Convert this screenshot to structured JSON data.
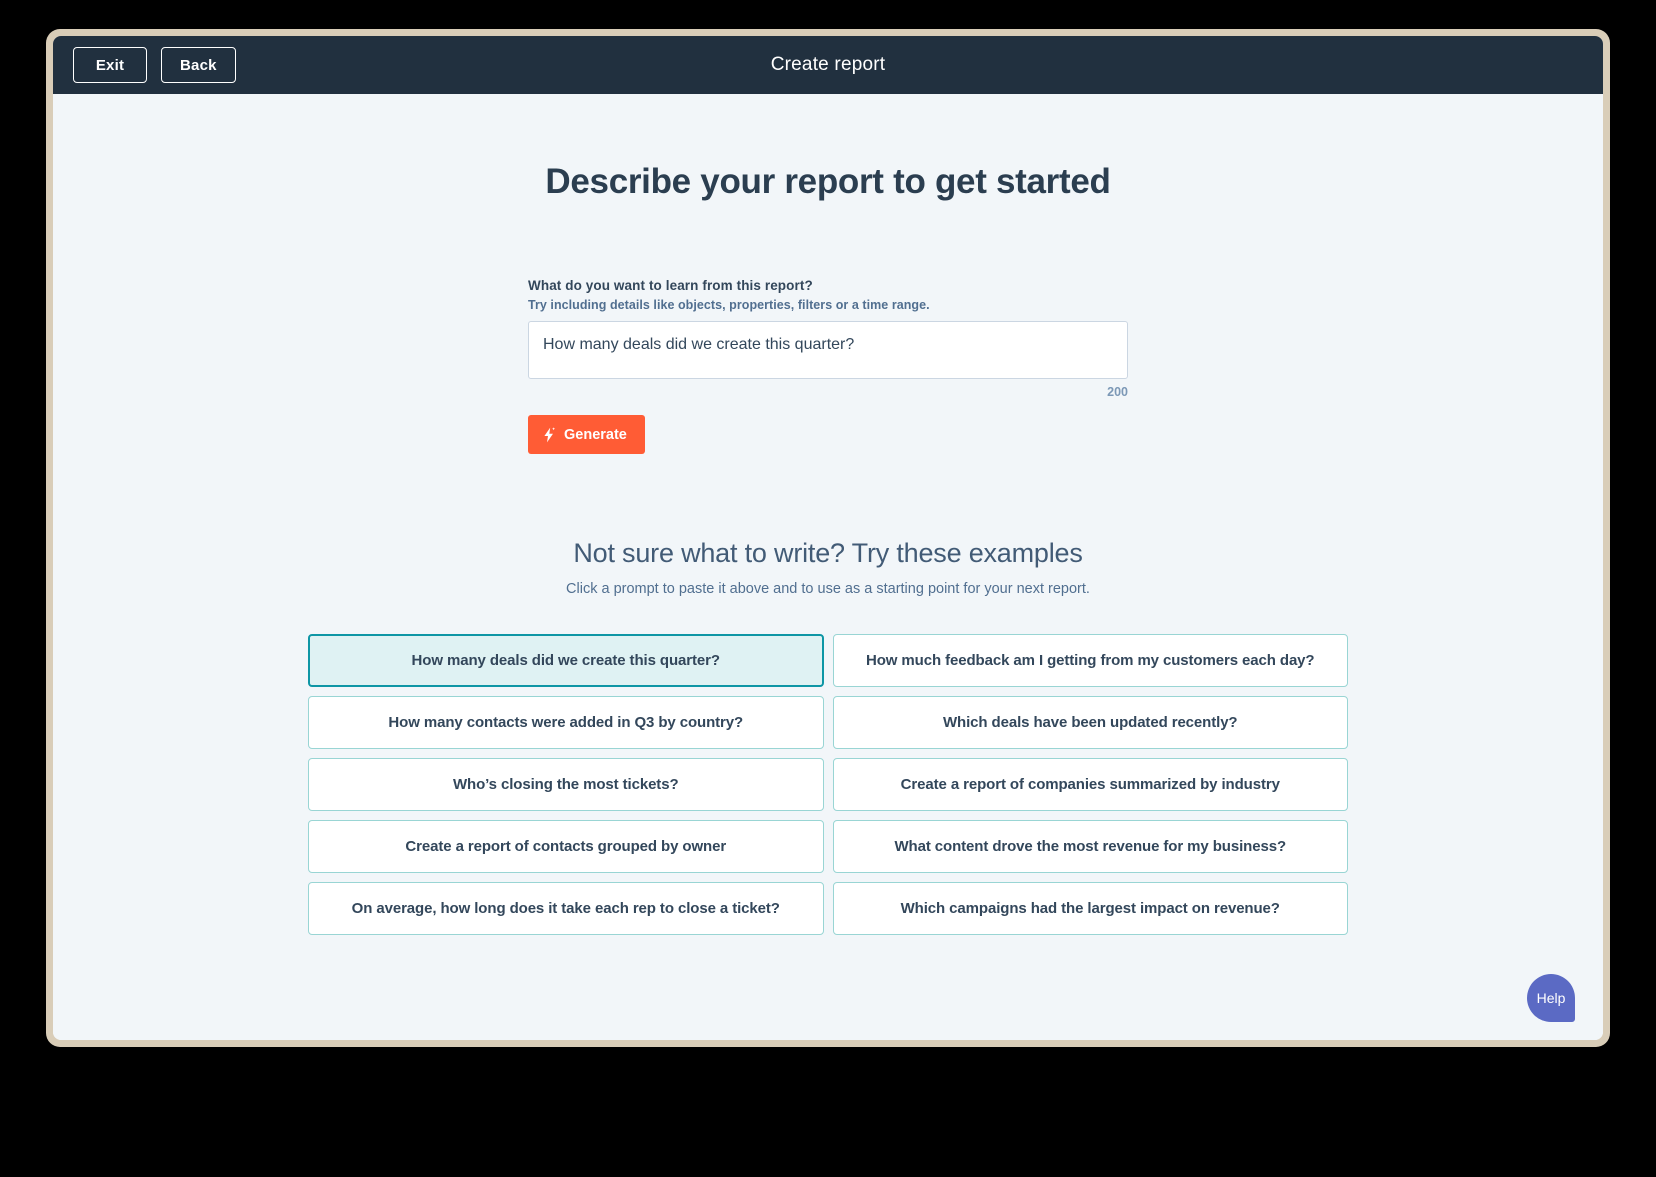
{
  "topbar": {
    "exit_label": "Exit",
    "back_label": "Back",
    "title": "Create report"
  },
  "page": {
    "heading": "Describe your report to get started"
  },
  "form": {
    "label": "What do you want to learn from this report?",
    "hint": "Try including details like objects, properties, filters or a time range.",
    "textarea_value": "How many deals did we create this quarter?",
    "textarea_placeholder": "How many deals did we create this quarter?",
    "char_counter": "200",
    "generate_label": "Generate",
    "generate_icon": "lightning-bolt-icon"
  },
  "examples": {
    "title": "Not sure what to write? Try these examples",
    "subtitle": "Click a prompt to paste it above and to use as a starting point for your next report.",
    "prompts": [
      {
        "label": "How many deals did we create this quarter?",
        "selected": true
      },
      {
        "label": "How much feedback am I getting from my customers each day?",
        "selected": false
      },
      {
        "label": "How many contacts were added in Q3 by country?",
        "selected": false
      },
      {
        "label": "Which deals have been updated recently?",
        "selected": false
      },
      {
        "label": "Who’s closing the most tickets?",
        "selected": false
      },
      {
        "label": "Create a report of companies summarized by industry",
        "selected": false
      },
      {
        "label": "Create a report of contacts grouped by owner",
        "selected": false
      },
      {
        "label": "What content drove the most revenue for my business?",
        "selected": false
      },
      {
        "label": "On average, how long does it take each rep to close a ticket?",
        "selected": false
      },
      {
        "label": "Which campaigns had the largest impact on revenue?",
        "selected": false
      }
    ]
  },
  "help": {
    "label": "Help"
  },
  "colors": {
    "topbar_bg": "#21303f",
    "page_bg": "#f2f6f9",
    "accent_orange": "#ff5c35",
    "selected_border": "#0e96a5",
    "selected_bg": "#dff2f3",
    "card_border": "#99d5d4",
    "help_bg": "#5b6ac4",
    "frame_bg": "#d9cdb8"
  }
}
